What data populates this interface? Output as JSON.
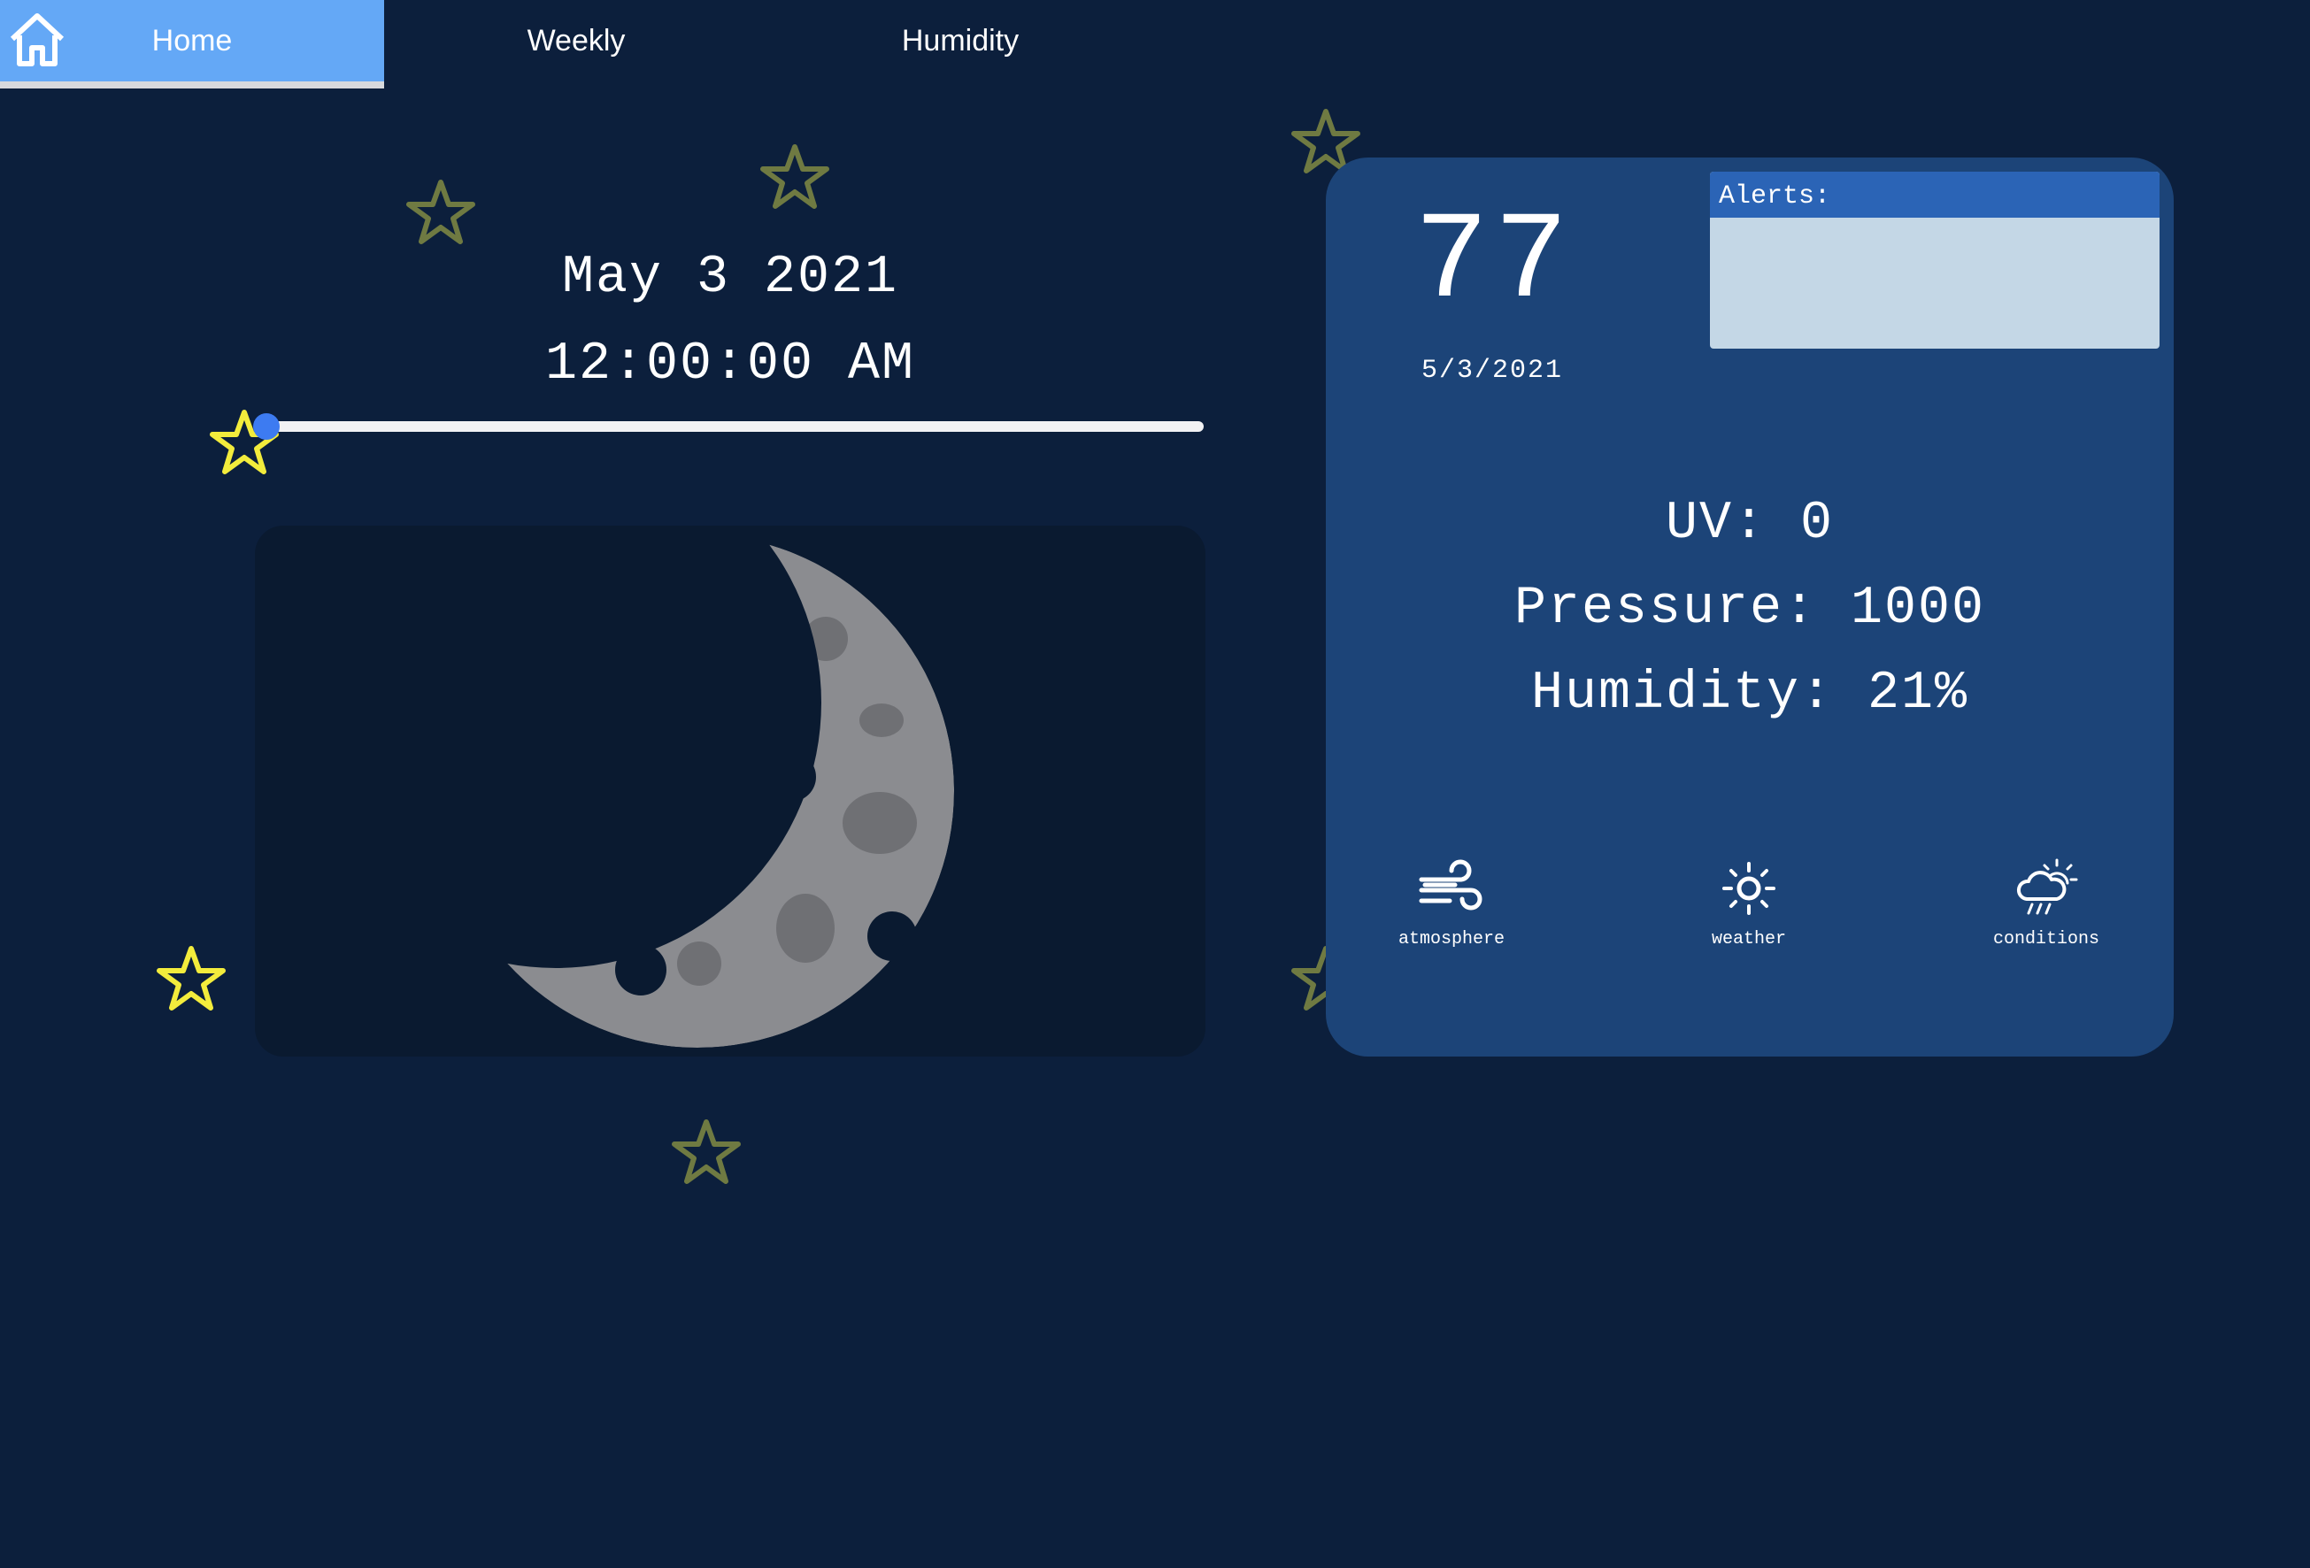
{
  "nav": {
    "tabs": [
      {
        "label": "Home",
        "active": true
      },
      {
        "label": "Weekly",
        "active": false
      },
      {
        "label": "Humidity",
        "active": false
      }
    ]
  },
  "clock": {
    "date": "May 3 2021",
    "time": "12:00:00 AM",
    "slider_fraction": 0
  },
  "moon": {
    "phase_icon": "waning-crescent-moon-icon"
  },
  "weather": {
    "temperature": "77",
    "date": "5/3/2021",
    "alerts_label": "Alerts:",
    "uv": "UV: 0",
    "pressure": "Pressure: 1000",
    "humidity": "Humidity: 21%",
    "buttons": [
      {
        "label": "atmosphere",
        "icon": "wind-icon"
      },
      {
        "label": "weather",
        "icon": "sun-icon"
      },
      {
        "label": "conditions",
        "icon": "sun-cloud-rain-icon"
      }
    ]
  },
  "colors": {
    "background": "#0c1f3c",
    "nav_active": "#64a8f6",
    "card": "#1c4478",
    "alerts_header": "#2b64b6",
    "alerts_body": "#c4d7e6",
    "slider_thumb": "#3d7bf1",
    "star_bright": "#f3ec3c",
    "star_dim": "#6f7a42"
  }
}
